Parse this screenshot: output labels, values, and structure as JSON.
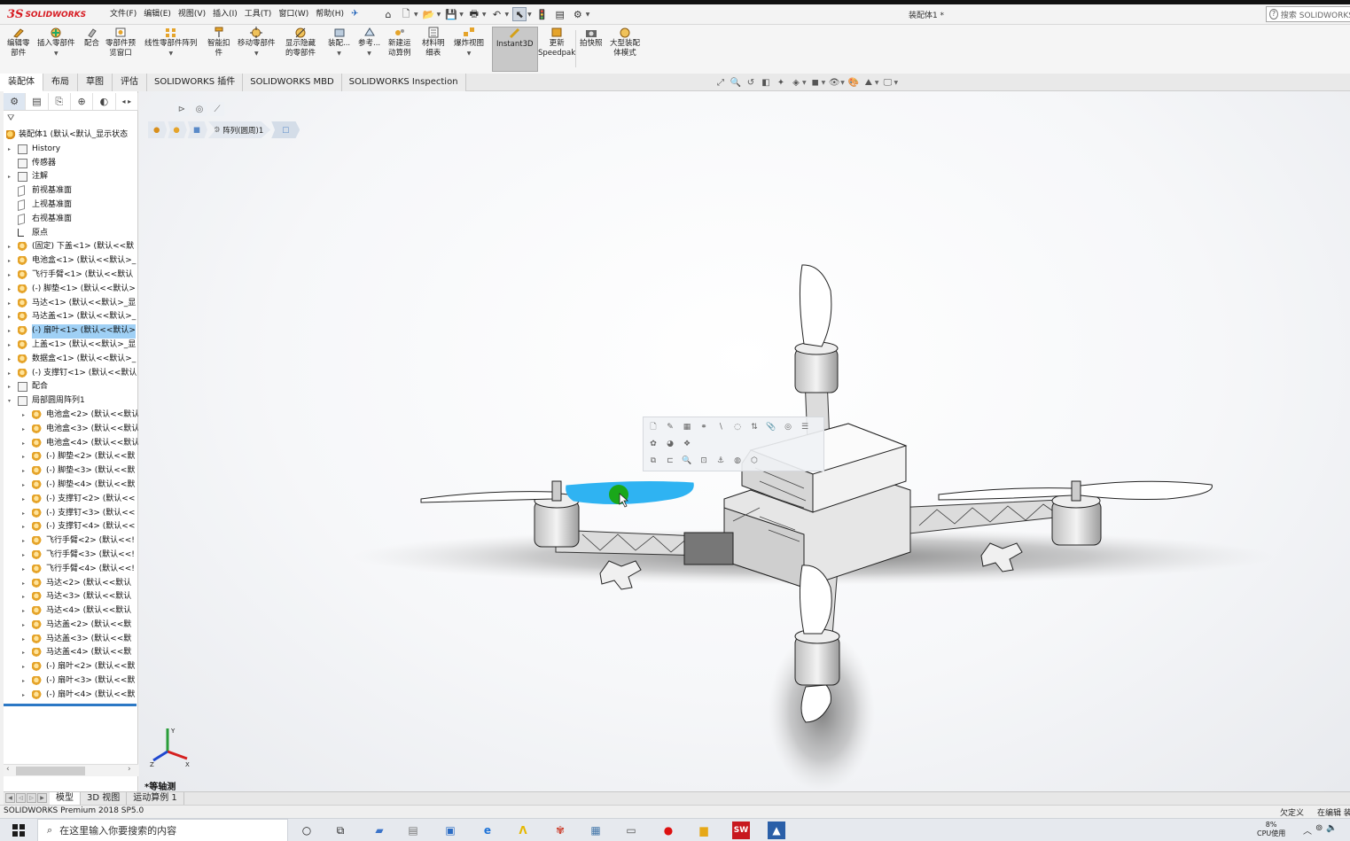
{
  "app": {
    "logo_mark": "3S",
    "logo_word": "SOLIDWORKS",
    "document_title": "装配体1 *"
  },
  "menus": [
    "文件(F)",
    "编辑(E)",
    "视图(V)",
    "插入(I)",
    "工具(T)",
    "窗口(W)",
    "帮助(H)"
  ],
  "search": {
    "placeholder": "搜索 SOLIDWORKS"
  },
  "ribbon": [
    {
      "l1": "编辑零",
      "l2": "部件"
    },
    {
      "l1": "插入零部件",
      "l2": ""
    },
    {
      "l1": "配合",
      "l2": ""
    },
    {
      "l1": "零部件预",
      "l2": "览窗口"
    },
    {
      "l1": "线性零部件阵列",
      "l2": ""
    },
    {
      "l1": "智能扣",
      "l2": "件"
    },
    {
      "l1": "移动零部件",
      "l2": ""
    },
    {
      "l1": "显示隐藏",
      "l2": "的零部件"
    },
    {
      "l1": "装配...",
      "l2": ""
    },
    {
      "l1": "参考...",
      "l2": ""
    },
    {
      "l1": "新建运",
      "l2": "动算例"
    },
    {
      "l1": "材料明",
      "l2": "细表"
    },
    {
      "l1": "爆炸视图",
      "l2": ""
    },
    {
      "l1": "Instant3D",
      "l2": ""
    },
    {
      "l1": "更新",
      "l2": "Speedpak"
    },
    {
      "l1": "拍快照",
      "l2": ""
    },
    {
      "l1": "大型装配",
      "l2": "体模式"
    }
  ],
  "tabs": [
    "装配体",
    "布局",
    "草图",
    "评估",
    "SOLIDWORKS 插件",
    "SOLIDWORKS MBD",
    "SOLIDWORKS Inspection"
  ],
  "tree": {
    "root": "装配体1 (默认<默认_显示状态",
    "items": [
      {
        "label": "History"
      },
      {
        "label": "传感器"
      },
      {
        "label": "注解"
      },
      {
        "label": "前视基准面"
      },
      {
        "label": "上视基准面"
      },
      {
        "label": "右视基准面"
      },
      {
        "label": "原点"
      },
      {
        "label": "(固定) 下盖<1> (默认<<默"
      },
      {
        "label": "电池盒<1> (默认<<默认>_"
      },
      {
        "label": "飞行手臂<1> (默认<<默认"
      },
      {
        "label": "(-) 脚垫<1> (默认<<默认>"
      },
      {
        "label": "马达<1> (默认<<默认>_显"
      },
      {
        "label": "马达盖<1> (默认<<默认>_"
      },
      {
        "label": "(-) 扇叶<1> (默认<<默认>"
      },
      {
        "label": "上盖<1> (默认<<默认>_显"
      },
      {
        "label": "数据盒<1> (默认<<默认>_"
      },
      {
        "label": "(-) 支撑钉<1> (默认<<默认"
      },
      {
        "label": "配合"
      },
      {
        "label": "局部圆周阵列1"
      },
      {
        "label": "电池盒<2> (默认<<默认"
      },
      {
        "label": "电池盒<3> (默认<<默认"
      },
      {
        "label": "电池盒<4> (默认<<默认"
      },
      {
        "label": "(-) 脚垫<2> (默认<<默"
      },
      {
        "label": "(-) 脚垫<3> (默认<<默"
      },
      {
        "label": "(-) 脚垫<4> (默认<<默"
      },
      {
        "label": "(-) 支撑钉<2> (默认<<"
      },
      {
        "label": "(-) 支撑钉<3> (默认<<"
      },
      {
        "label": "(-) 支撑钉<4> (默认<<"
      },
      {
        "label": "飞行手臂<2> (默认<<!"
      },
      {
        "label": "飞行手臂<3> (默认<<!"
      },
      {
        "label": "飞行手臂<4> (默认<<!"
      },
      {
        "label": "马达<2> (默认<<默认"
      },
      {
        "label": "马达<3> (默认<<默认"
      },
      {
        "label": "马达<4> (默认<<默认"
      },
      {
        "label": "马达盖<2> (默认<<默"
      },
      {
        "label": "马达盖<3> (默认<<默"
      },
      {
        "label": "马达盖<4> (默认<<默"
      },
      {
        "label": "(-) 扇叶<2> (默认<<默"
      },
      {
        "label": "(-) 扇叶<3> (默认<<默"
      },
      {
        "label": "(-) 扇叶<4> (默认<<默"
      }
    ]
  },
  "breadcrumb": {
    "feature": "阵列(圆周)1"
  },
  "viewport": {
    "view_label": "*等轴测",
    "selection_color": "#2fb3f2",
    "cursor_color": "#1aa71a",
    "triad": {
      "x": "X",
      "y": "Y",
      "z": "Z"
    }
  },
  "bottom_tabs": [
    "模型",
    "3D 视图",
    "运动算例 1"
  ],
  "status": {
    "left": "SOLIDWORKS Premium 2018 SP5.0",
    "right1": "欠定义",
    "right2": "在编辑 装"
  },
  "taskbar": {
    "search_placeholder": "在这里输入你要搜索的内容",
    "cpu_percent": "8%",
    "cpu_label": "CPU使用"
  }
}
